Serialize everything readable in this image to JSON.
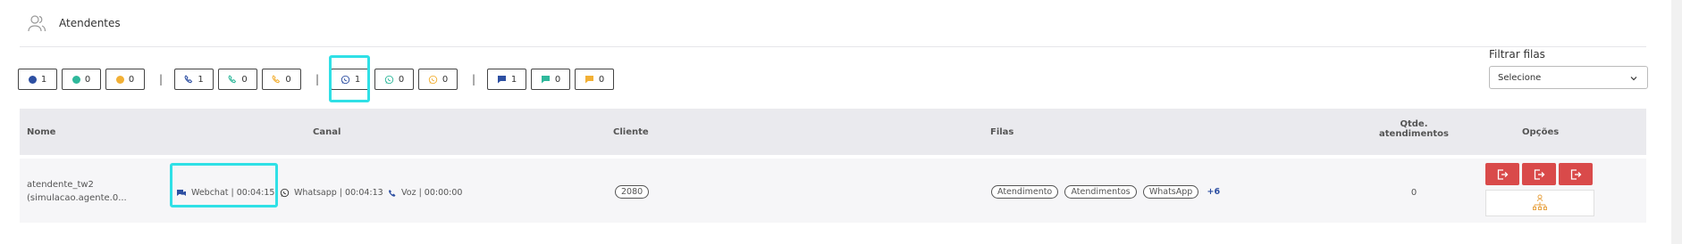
{
  "header": {
    "title": "Atendentes",
    "icon": "users-icon"
  },
  "status_groups": {
    "status": [
      {
        "icon": "circle-dot-icon",
        "color": "#2d4fa2",
        "count": "1"
      },
      {
        "icon": "circle-dot-icon",
        "color": "#2fb89b",
        "count": "0"
      },
      {
        "icon": "circle-dot-icon",
        "color": "#f2b035",
        "count": "0"
      }
    ],
    "voice": [
      {
        "icon": "phone-icon",
        "color": "#2d4fa2",
        "count": "1"
      },
      {
        "icon": "phone-icon",
        "color": "#2fb89b",
        "count": "0"
      },
      {
        "icon": "phone-icon",
        "color": "#f2b035",
        "count": "0"
      }
    ],
    "whatsapp": [
      {
        "icon": "whatsapp-icon",
        "color": "#2d4fa2",
        "count": "1"
      },
      {
        "icon": "whatsapp-icon",
        "color": "#2fb89b",
        "count": "0"
      },
      {
        "icon": "whatsapp-icon",
        "color": "#f2b035",
        "count": "0"
      }
    ],
    "chat": [
      {
        "icon": "chat-bubble-icon",
        "color": "#2d4fa2",
        "count": "1"
      },
      {
        "icon": "chat-bubble-icon",
        "color": "#2fb89b",
        "count": "0"
      },
      {
        "icon": "chat-bubble-icon",
        "color": "#f2b035",
        "count": "0"
      }
    ],
    "separator": "|"
  },
  "filter": {
    "label": "Filtrar filas",
    "value": "Selecione"
  },
  "table": {
    "columns": {
      "nome": "Nome",
      "canal": "Canal",
      "cliente": "Cliente",
      "filas": "Filas",
      "qtde_1": "Qtde.",
      "qtde_2": "atendimentos",
      "opcoes": "Opções"
    },
    "rows": [
      {
        "nome_1": "atendente_tw2",
        "nome_2": "(simulacao.agente.0...",
        "canal": {
          "webchat": "Webchat | 00:04:15",
          "whatsapp": "Whatsapp | 00:04:13",
          "voz": "Voz | 00:00:00"
        },
        "cliente": "2080",
        "filas": [
          "Atendimento",
          "Atendimentos",
          "WhatsApp"
        ],
        "filas_more": "+6",
        "qtde": "0"
      }
    ]
  },
  "colors": {
    "accent": "#2d4fa2",
    "danger": "#d94a4a",
    "highlight": "#2fe0e6",
    "org_icon": "#e8a64a"
  }
}
